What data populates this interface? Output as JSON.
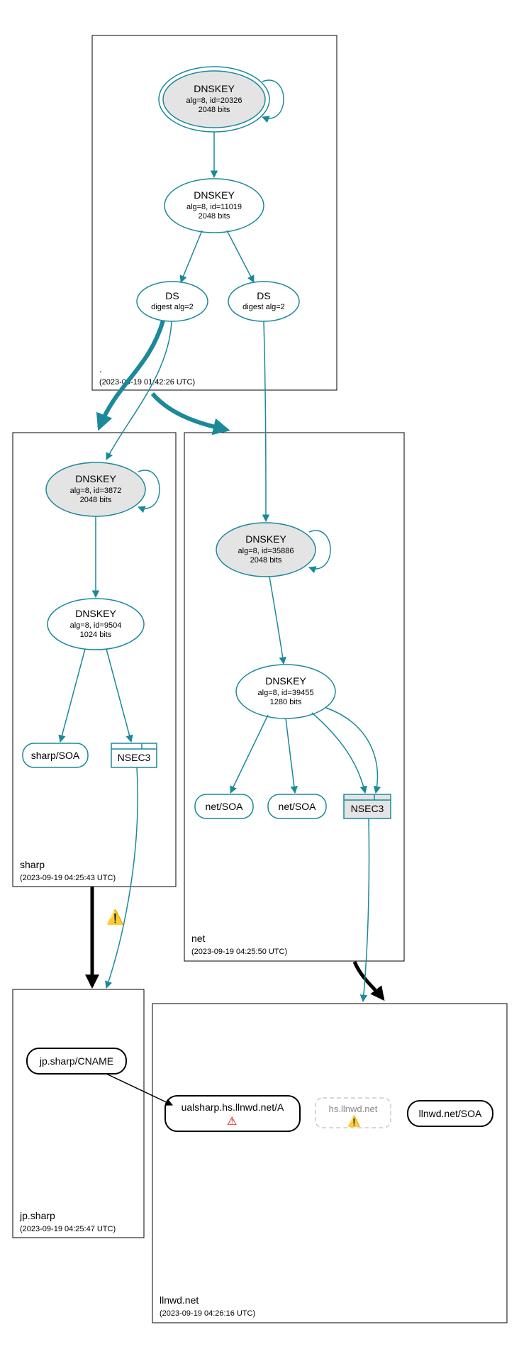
{
  "colors": {
    "teal": "#1b899a",
    "grey": "#e4e4e4",
    "dashed": "#cccccc"
  },
  "zones": {
    "root": {
      "name": ".",
      "time": "(2023-09-19 01:42:26 UTC)"
    },
    "sharp": {
      "name": "sharp",
      "time": "(2023-09-19 04:25:43 UTC)"
    },
    "net": {
      "name": "net",
      "time": "(2023-09-19 04:25:50 UTC)"
    },
    "jpsharp": {
      "name": "jp.sharp",
      "time": "(2023-09-19 04:25:47 UTC)"
    },
    "llnwd": {
      "name": "llnwd.net",
      "time": "(2023-09-19 04:26:16 UTC)"
    }
  },
  "nodes": {
    "root_ksk": {
      "title": "DNSKEY",
      "line2": "alg=8, id=20326",
      "line3": "2048 bits"
    },
    "root_zsk": {
      "title": "DNSKEY",
      "line2": "alg=8, id=11019",
      "line3": "2048 bits"
    },
    "root_ds1": {
      "title": "DS",
      "line2": "digest alg=2"
    },
    "root_ds2": {
      "title": "DS",
      "line2": "digest alg=2"
    },
    "sharp_ksk": {
      "title": "DNSKEY",
      "line2": "alg=8, id=3872",
      "line3": "2048 bits"
    },
    "sharp_zsk": {
      "title": "DNSKEY",
      "line2": "alg=8, id=9504",
      "line3": "1024 bits"
    },
    "sharp_soa": {
      "title": "sharp/SOA"
    },
    "sharp_nsec3": {
      "title": "NSEC3"
    },
    "net_ksk": {
      "title": "DNSKEY",
      "line2": "alg=8, id=35886",
      "line3": "2048 bits"
    },
    "net_zsk": {
      "title": "DNSKEY",
      "line2": "alg=8, id=39455",
      "line3": "1280 bits"
    },
    "net_soa1": {
      "title": "net/SOA"
    },
    "net_soa2": {
      "title": "net/SOA"
    },
    "net_nsec3": {
      "title": "NSEC3"
    },
    "jp_cname": {
      "title": "jp.sharp/CNAME"
    },
    "ual_a": {
      "title": "ualsharp.hs.llnwd.net/A"
    },
    "hs_llnwd": {
      "title": "hs.llnwd.net"
    },
    "llnwd_soa": {
      "title": "llnwd.net/SOA"
    }
  },
  "icons": {
    "warn": "⚠",
    "err": "⚠"
  }
}
